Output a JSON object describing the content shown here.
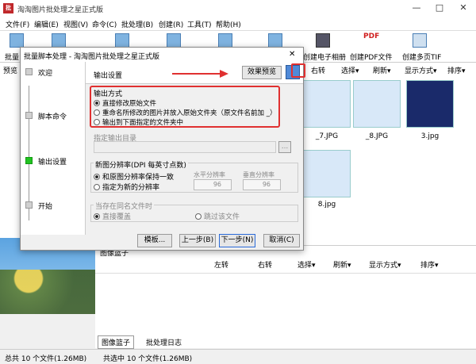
{
  "app": {
    "logo": "批",
    "title": "淘淘图片批处理之星正式版",
    "controls": [
      "—",
      "□",
      "✕"
    ]
  },
  "menu": [
    "文件(F)",
    "编辑(E)",
    "视图(V)",
    "命令(C)",
    "批处理(B)",
    "创建(R)",
    "工具(T)",
    "帮助(H)"
  ],
  "toolbar": {
    "partial_left": "批量",
    "items": [
      "创建电子相册",
      "创建PDF文件",
      "创建多页TIF"
    ],
    "pdf_badge": "PDF"
  },
  "preview": {
    "label": "预览"
  },
  "right_toolbar": {
    "rotate_right": "右转",
    "select": "选择▾",
    "refresh": "刷新▾",
    "display": "显示方式▾",
    "sort": "排序▾"
  },
  "thumbs": [
    {
      "label": "_7.JPG"
    },
    {
      "label": "_8.JPG"
    },
    {
      "label": "3.jpg"
    },
    {
      "label": "8.jpg"
    }
  ],
  "bottom": {
    "title": "图像篮子",
    "toolbar": {
      "rotate_left": "左转",
      "rotate_right": "右转",
      "select": "选择▾",
      "refresh": "刷新▾",
      "display": "显示方式▾",
      "sort": "排序▾"
    },
    "tabs": [
      "图像篮子",
      "批处理日志"
    ]
  },
  "status": {
    "total": "总共 10 个文件(1.26MB)",
    "selected": "共选中 10 个文件(1.26MB)"
  },
  "dialog": {
    "title": "批量脚本处理 - 淘淘图片批处理之星正式版",
    "close": "✕",
    "steps": [
      {
        "label": "欢迎"
      },
      {
        "label": "脚本命令"
      },
      {
        "label": "输出设置"
      },
      {
        "label": "开始"
      }
    ],
    "header": "输出设置",
    "preview_button": "效果预览",
    "output_mode": {
      "title": "输出方式",
      "options": [
        "直接修改原始文件",
        "重命名所修改的图片并放入原始文件夹（原文件名前加 _）",
        "输出到下面指定的文件夹中"
      ],
      "selected": 0
    },
    "output_dir": {
      "label": "指定输出目录",
      "value": "",
      "browse": "..."
    },
    "resolution": {
      "title": "新图分辨率(DPI 每英寸点数)",
      "options": [
        "和原图分辨率保持一致",
        "指定为新的分辨率"
      ],
      "selected": 0,
      "h_label": "水平分辨率",
      "v_label": "垂直分辨率",
      "h_value": "96",
      "v_value": "96"
    },
    "samename": {
      "title": "当存在同名文件时",
      "options": [
        "直接覆盖",
        "跳过该文件"
      ],
      "selected": 0
    },
    "buttons": {
      "template": "模板...",
      "prev": "上一步(B)",
      "next": "下一步(N)",
      "cancel": "取消(C)"
    }
  },
  "annotation_color": "#e03030"
}
